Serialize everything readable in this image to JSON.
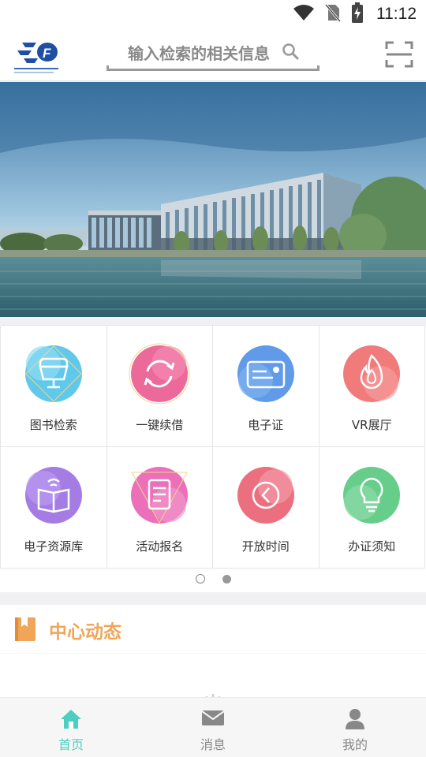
{
  "status_bar": {
    "time": "11:12",
    "icons": [
      "wifi-icon",
      "no-sim-icon",
      "battery-charging-icon"
    ]
  },
  "header": {
    "logo_icon": "library-logo",
    "search_placeholder": "输入检索的相关信息",
    "search_icon": "search-icon",
    "scan_icon": "scan-icon"
  },
  "banner": {
    "image": "library-building-photo"
  },
  "services": [
    {
      "label": "图书检索",
      "icon": "book-search-icon",
      "color": "#4fc3e9"
    },
    {
      "label": "一键续借",
      "icon": "renew-icon",
      "color": "#ea5a8f"
    },
    {
      "label": "电子证",
      "icon": "ecard-icon",
      "color": "#4f8fe6"
    },
    {
      "label": "VR展厅",
      "icon": "fire-icon",
      "color": "#ef6b6b"
    },
    {
      "label": "电子资源库",
      "icon": "ebook-icon",
      "color": "#9a6ee0"
    },
    {
      "label": "活动报名",
      "icon": "signup-icon",
      "color": "#e961b1"
    },
    {
      "label": "开放时间",
      "icon": "clock-icon",
      "color": "#ea5f72"
    },
    {
      "label": "办证须知",
      "icon": "lightbulb-icon",
      "color": "#55c87d"
    }
  ],
  "pager": {
    "current": 2,
    "total": 2
  },
  "news": {
    "title": "中心动态",
    "icon": "bookmark-book-icon",
    "accent": "#f0a558"
  },
  "tabs": [
    {
      "label": "首页",
      "icon": "home-icon",
      "active": true
    },
    {
      "label": "消息",
      "icon": "mail-icon",
      "active": false
    },
    {
      "label": "我的",
      "icon": "user-icon",
      "active": false
    }
  ],
  "colors": {
    "tab_active": "#4ccfc1",
    "tab_inactive": "#888888"
  }
}
